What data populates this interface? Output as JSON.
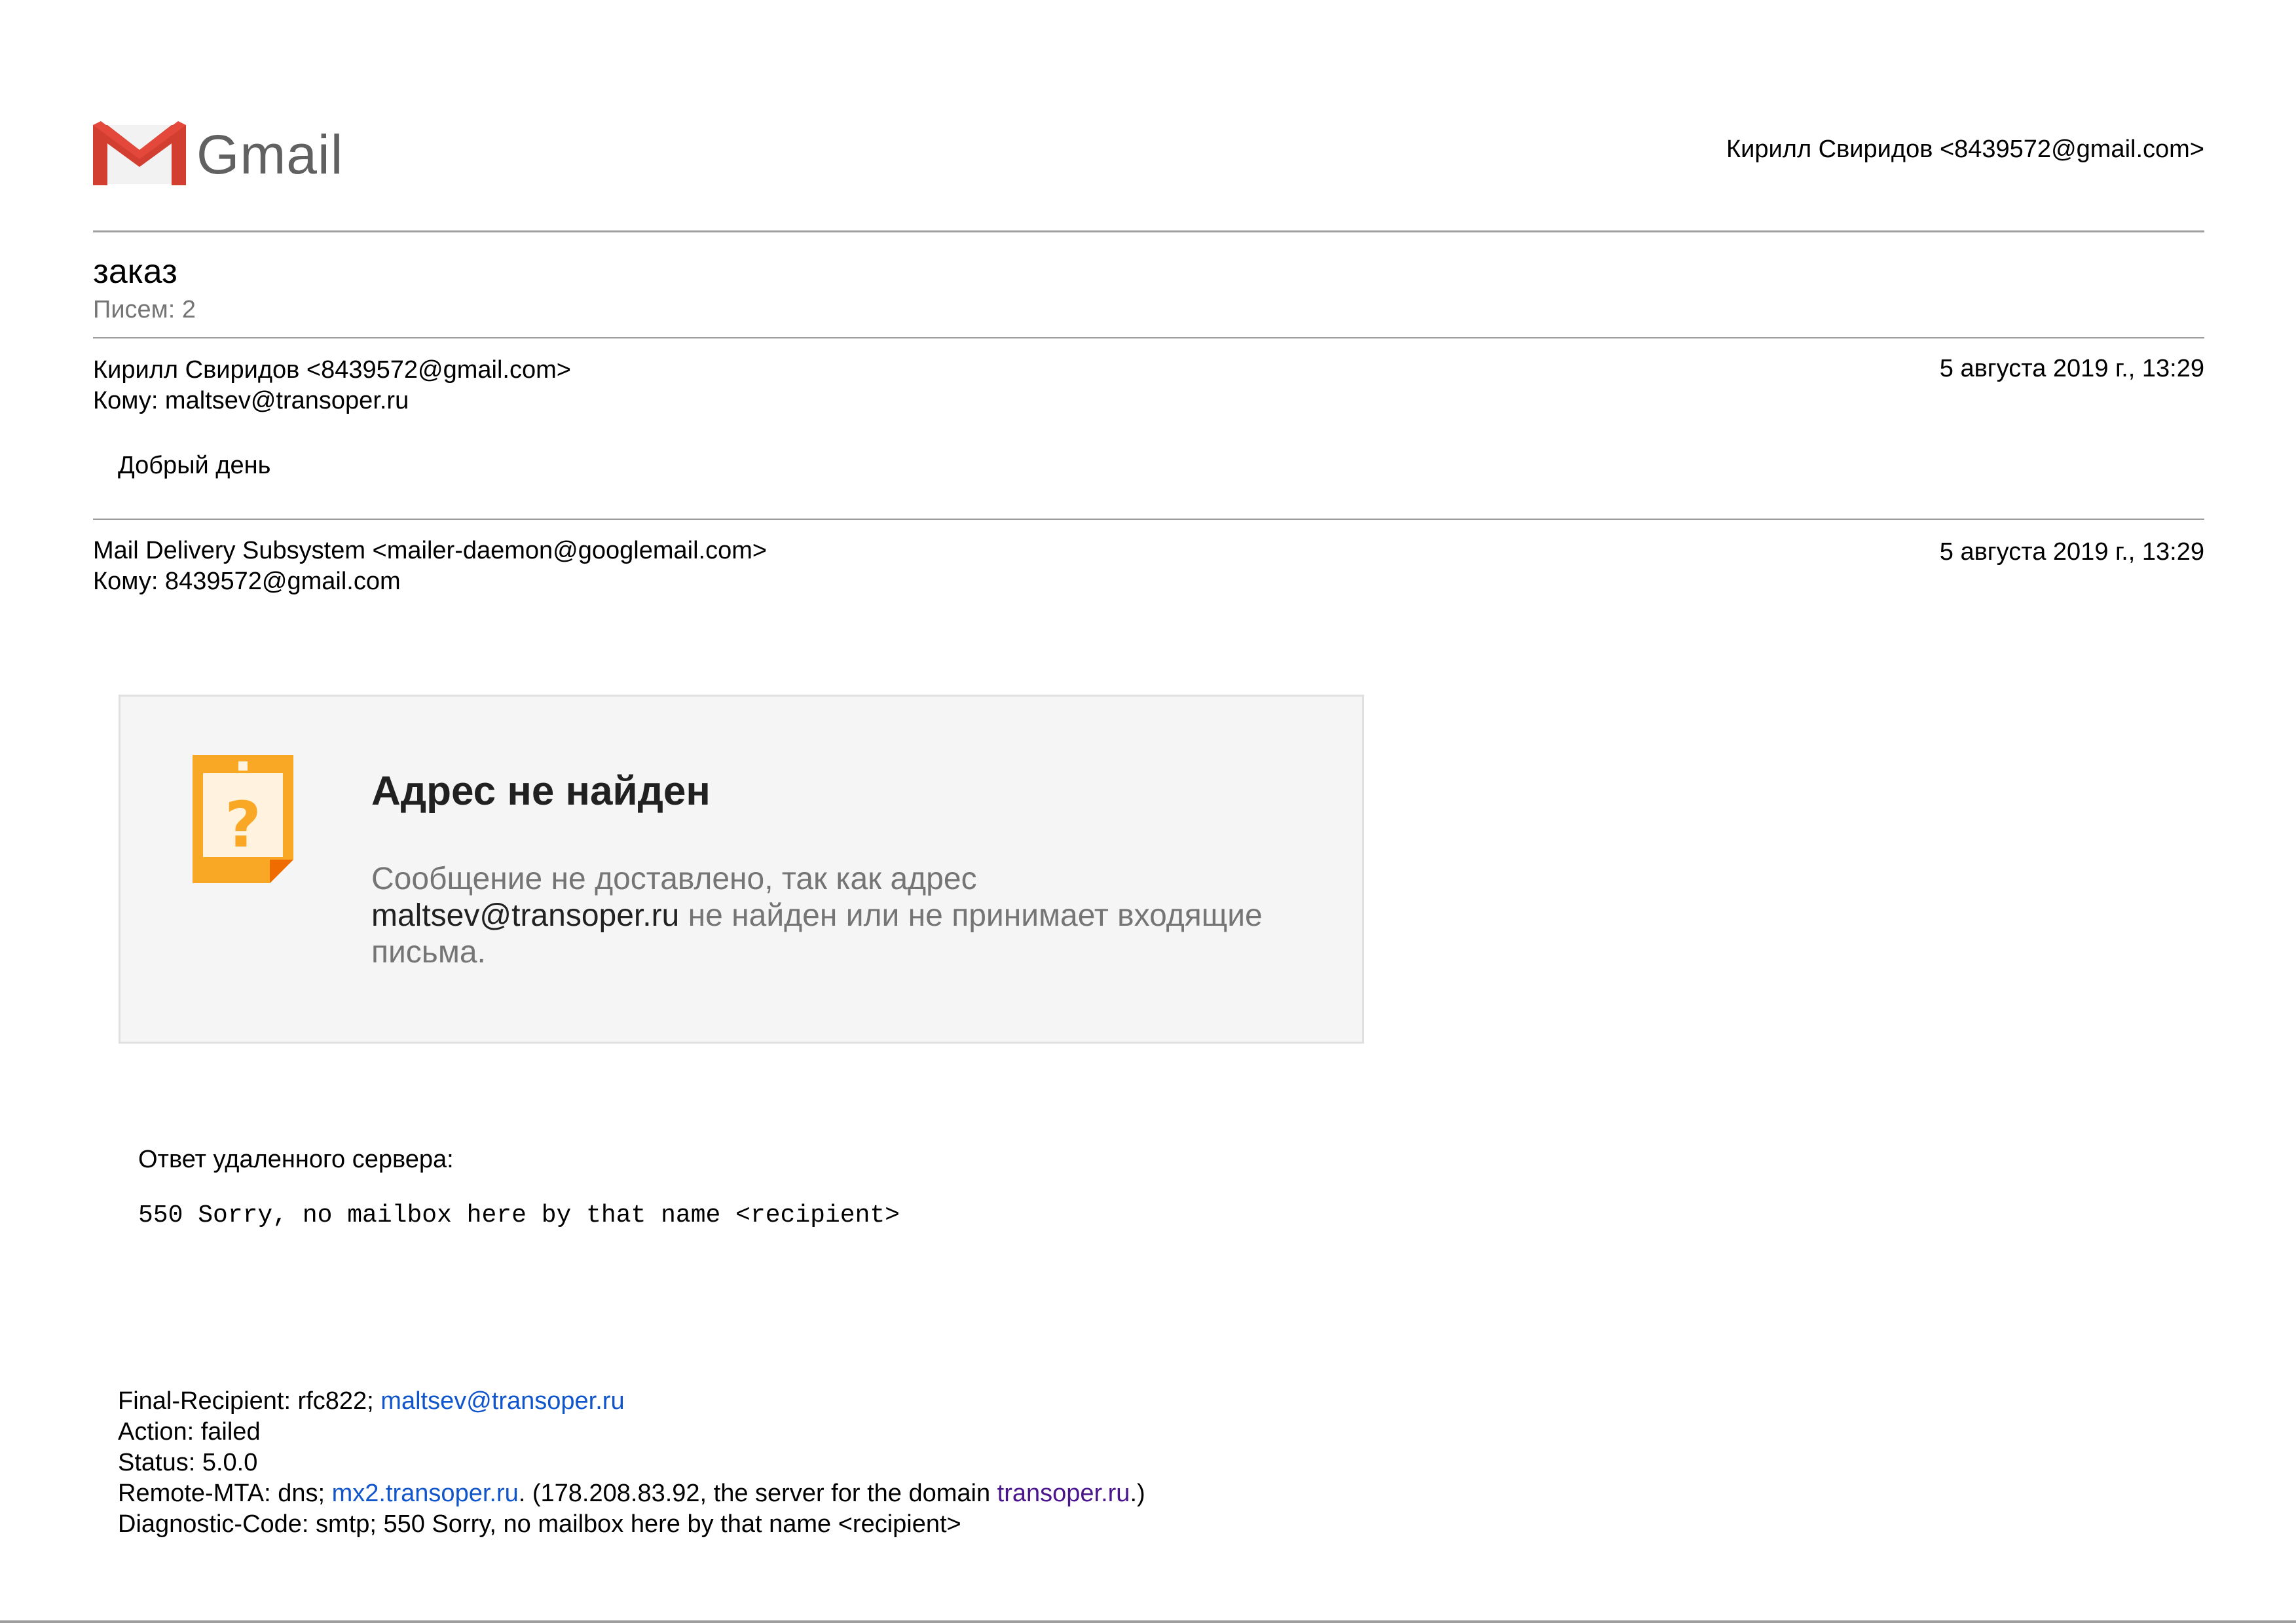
{
  "header": {
    "logo_icon": "gmail-m-icon",
    "wordmark": "Gmail",
    "account": "Кирилл Свиридов <8439572@gmail.com>"
  },
  "thread": {
    "subject": "заказ",
    "count": "Писем: 2"
  },
  "messages": [
    {
      "from": "Кирилл Свиридов <8439572@gmail.com>",
      "to": "Кому: maltsev@transoper.ru",
      "date": "5 августа 2019 г., 13:29",
      "body": "Добрый день"
    },
    {
      "from": "Mail Delivery Subsystem <mailer-daemon@googlemail.com>",
      "to": "Кому: 8439572@gmail.com",
      "date": "5 августа 2019 г., 13:29"
    }
  ],
  "bounce": {
    "icon": "question-document-icon",
    "title": "Адрес не найден",
    "desc_before": "Сообщение не доставлено, так как адрес",
    "address": "maltsev@transoper.ru",
    "desc_after": " не найден или не принимает входящие письма.",
    "remote_label": "Ответ удаленного сервера:",
    "remote_code": "550 Sorry, no mailbox here by that name <recipient>"
  },
  "dsn": {
    "final_recipient_prefix": "Final-Recipient: rfc822; ",
    "final_recipient_link": "maltsev@transoper.ru",
    "action": "Action: failed",
    "status": "Status: 5.0.0",
    "remote_mta_prefix": "Remote-MTA: dns; ",
    "remote_mta_link": "mx2.transoper.ru",
    "remote_mta_middle": ". (178.208.83.92, the server for the domain ",
    "remote_mta_domain": "transoper.ru",
    "remote_mta_suffix": ".)",
    "diagnostic": "Diagnostic-Code: smtp; 550 Sorry, no mailbox here by that name <recipient>"
  },
  "colors": {
    "link": "#1155cc",
    "visited_link": "#4a148c",
    "gmail_red": "#d93025",
    "icon_orange": "#f9a825"
  }
}
